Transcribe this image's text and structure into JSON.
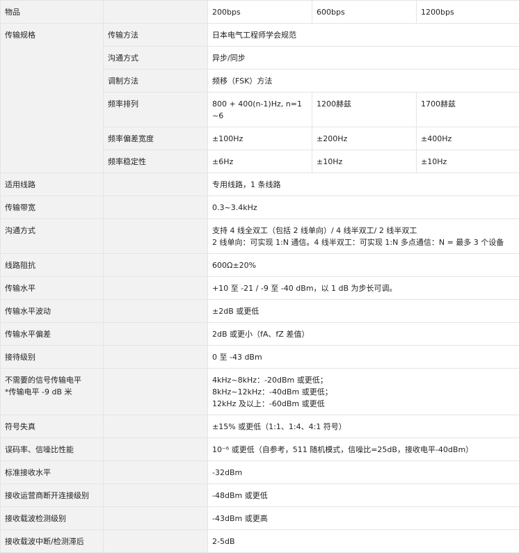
{
  "header": {
    "item": "物品",
    "speeds": [
      "200bps",
      "600bps",
      "1200bps"
    ]
  },
  "transmission_spec": {
    "label": "传输规格",
    "sub": [
      {
        "label": "传输方法",
        "value": "日本电气工程师学会规范"
      },
      {
        "label": "沟通方式",
        "value": "异步/同步"
      },
      {
        "label": "调制方法",
        "value": "频移（FSK）方法"
      },
      {
        "label": "频率排列",
        "values": [
          "800 + 400(n-1)Hz, n=1~6",
          "1200赫兹",
          "1700赫兹"
        ]
      },
      {
        "label": "频率偏差宽度",
        "values": [
          "±100Hz",
          "±200Hz",
          "±400Hz"
        ]
      },
      {
        "label": "频率稳定性",
        "values": [
          "±6Hz",
          "±10Hz",
          "±10Hz"
        ]
      }
    ]
  },
  "rows": [
    {
      "label": [
        "适用线路"
      ],
      "value": [
        "专用线路，1 条线路"
      ]
    },
    {
      "label": [
        "传输带宽"
      ],
      "value": [
        "0.3~3.4kHz"
      ]
    },
    {
      "label": [
        "沟通方式"
      ],
      "value": [
        "支持 4 线全双工（包括 2 线单向）/ 4 线半双工/ 2 线半双工",
        "2 线单向：可实现 1:N 通信。4 线半双工：可实现 1:N 多点通信：N = 最多 3 个设备"
      ]
    },
    {
      "label": [
        "线路阻抗"
      ],
      "value": [
        "600Ω±20%"
      ]
    },
    {
      "label": [
        "传输水平"
      ],
      "value": [
        "+10 至 -21 / -9 至 -40 dBm，以 1 dB 为步长可调。"
      ]
    },
    {
      "label": [
        "传输水平波动"
      ],
      "value": [
        "±2dB 或更低"
      ]
    },
    {
      "label": [
        "传输水平偏差"
      ],
      "value": [
        "2dB 或更小（fA、fZ 差值）"
      ]
    },
    {
      "label": [
        "接待级别"
      ],
      "value": [
        "0 至 -43 dBm"
      ]
    },
    {
      "label": [
        "不需要的信号传输电平",
        "*传输电平 -9 dB 米"
      ],
      "value": [
        "4kHz~8kHz：-20dBm 或更低；",
        "8kHz~12kHz：-40dBm 或更低；",
        "12kHz 及以上：-60dBm 或更低"
      ]
    },
    {
      "label": [
        "符号失真"
      ],
      "value": [
        "±15% 或更低（1:1、1:4、4:1 符号）"
      ]
    },
    {
      "label": [
        "误码率、信噪比性能"
      ],
      "value": [
        "10⁻⁶ 或更低（自参考，511 随机模式，信噪比=25dB，接收电平-40dBm）"
      ]
    },
    {
      "label": [
        "标准接收水平"
      ],
      "value": [
        "-32dBm"
      ]
    },
    {
      "label": [
        "接收运营商断开连接级别"
      ],
      "value": [
        "-48dBm 或更低"
      ]
    },
    {
      "label": [
        "接收载波检测级别"
      ],
      "value": [
        "-43dBm 或更高"
      ]
    },
    {
      "label": [
        "接收载波中断/检测滞后"
      ],
      "value": [
        "2-5dB"
      ]
    }
  ]
}
